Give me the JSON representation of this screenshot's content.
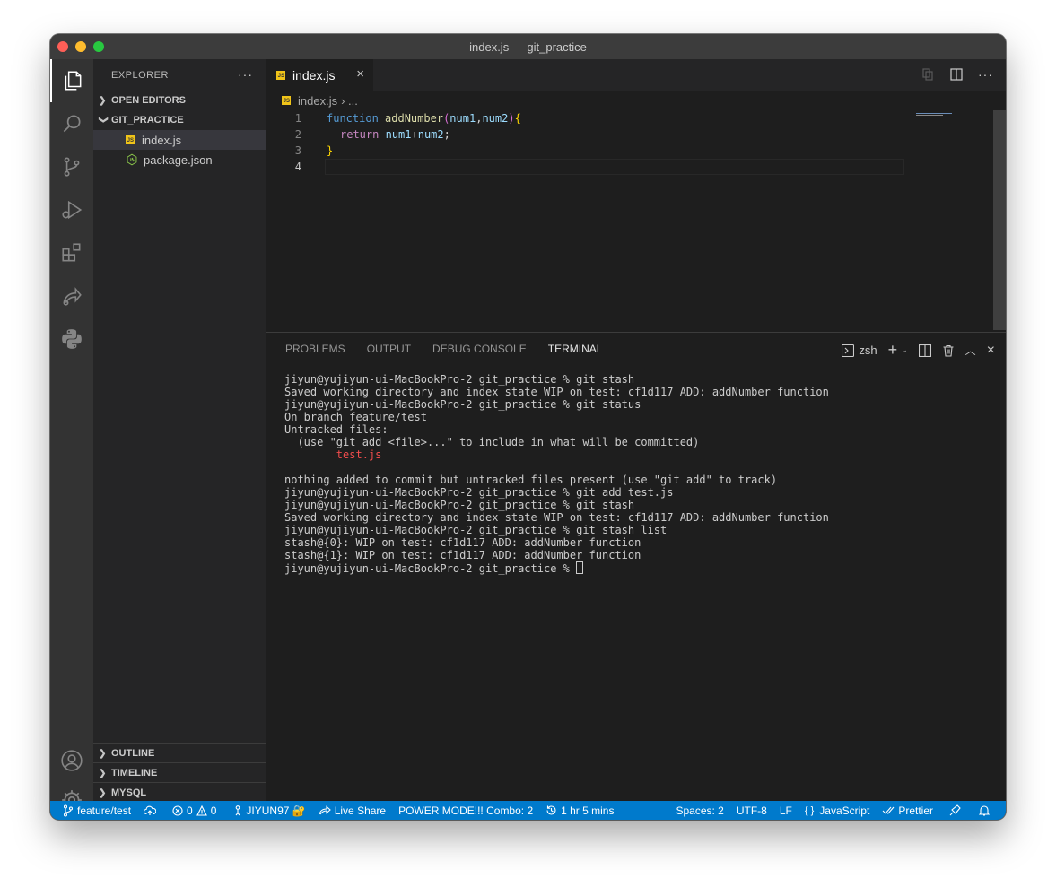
{
  "window": {
    "title": "index.js — git_practice"
  },
  "sidebar": {
    "header": "EXPLORER",
    "more": "···",
    "open_editors": "OPEN EDITORS",
    "folder": "GIT_PRACTICE",
    "files": [
      "index.js",
      "package.json"
    ],
    "outline": "OUTLINE",
    "timeline": "TIMELINE",
    "mysql": "MYSQL"
  },
  "editor": {
    "tab_label": "index.js",
    "tab_close": "×",
    "breadcrumb_file": "index.js",
    "breadcrumb_more": "›  ...",
    "line_numbers": [
      "1",
      "2",
      "3",
      "4"
    ],
    "code": {
      "l1_kw": "function",
      "l1_fn": "addNumber",
      "l1_open": "(",
      "l1_p1": "num1",
      "l1_comma": ", ",
      "l1_p2": "num2",
      "l1_close": ")",
      "l1_brace": " {",
      "l2_kw": "return",
      "l2_a": "num1",
      "l2_op": " + ",
      "l2_b": "num2",
      "l2_semi": ";",
      "l3_brace": "}"
    }
  },
  "panel": {
    "tabs": [
      "PROBLEMS",
      "OUTPUT",
      "DEBUG CONSOLE",
      "TERMINAL"
    ],
    "shell": "zsh",
    "terminal_lines": [
      "jiyun@yujiyun-ui-MacBookPro-2 git_practice % git stash",
      "Saved working directory and index state WIP on test: cf1d117 ADD: addNumber function",
      "jiyun@yujiyun-ui-MacBookPro-2 git_practice % git status",
      "On branch feature/test",
      "Untracked files:",
      "  (use \"git add <file>...\" to include in what will be committed)"
    ],
    "terminal_red": "        test.js",
    "terminal_lines_2": [
      "",
      "nothing added to commit but untracked files present (use \"git add\" to track)",
      "jiyun@yujiyun-ui-MacBookPro-2 git_practice % git add test.js",
      "jiyun@yujiyun-ui-MacBookPro-2 git_practice % git stash",
      "Saved working directory and index state WIP on test: cf1d117 ADD: addNumber function",
      "jiyun@yujiyun-ui-MacBookPro-2 git_practice % git stash list",
      "stash@{0}: WIP on test: cf1d117 ADD: addNumber function",
      "stash@{1}: WIP on test: cf1d117 ADD: addNumber function"
    ],
    "prompt": "jiyun@yujiyun-ui-MacBookPro-2 git_practice % "
  },
  "status": {
    "branch": "feature/test",
    "errors": "0",
    "warnings": "0",
    "user": "JIYUN97 🔐",
    "live_share": "Live Share",
    "power_mode": "POWER MODE!!! Combo: 2",
    "time": "1 hr 5 mins",
    "spaces": "Spaces: 2",
    "encoding": "UTF-8",
    "eol": "LF",
    "language": "JavaScript",
    "formatter": "Prettier"
  },
  "colors": {
    "accent": "#007acc",
    "background": "#1e1e1e",
    "sidebar": "#252526"
  }
}
